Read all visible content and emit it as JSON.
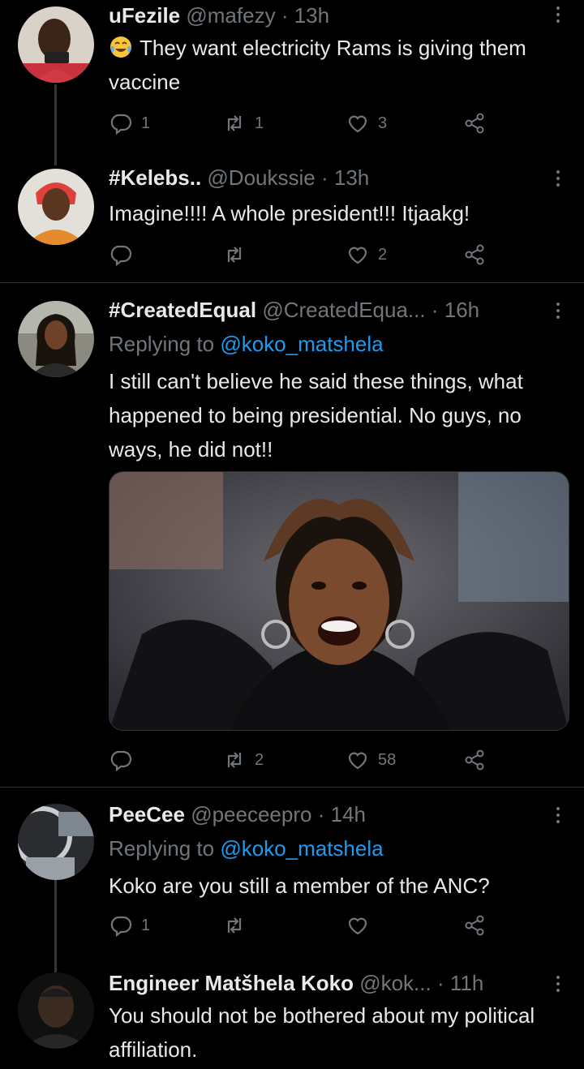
{
  "tweets": [
    {
      "name": "uFezile",
      "handle": "@mafezy",
      "sep": "·",
      "time": "13h",
      "text": "They want electricity Rams is giving them vaccine",
      "emoji": "face-with-tears-of-joy",
      "replies": "1",
      "retweets": "1",
      "likes": "3"
    },
    {
      "name": "#Kelebs..",
      "handle": "@Doukssie",
      "sep": "·",
      "time": "13h",
      "text": "Imagine!!!! A whole president!!! Itjaakg!",
      "replies": "",
      "retweets": "",
      "likes": "2"
    },
    {
      "name": "#CreatedEqual",
      "handle": "@CreatedEqua...",
      "sep": "·",
      "time": "16h",
      "replying_prefix": "Replying to",
      "replying_to": "@koko_matshela",
      "text": "I still can't believe he said these things, what happened to being presidential. No guys, no ways, he did not!!",
      "replies": "",
      "retweets": "2",
      "likes": "58"
    },
    {
      "name": "PeeCee",
      "handle": "@peeceepro",
      "sep": "·",
      "time": "14h",
      "replying_prefix": "Replying to",
      "replying_to": "@koko_matshela",
      "text": "Koko are you still a member of the ANC?",
      "replies": "1",
      "retweets": "",
      "likes": ""
    },
    {
      "name": "Engineer Matšhela Koko",
      "handle": "@kok...",
      "sep": "·",
      "time": "11h",
      "text": "You should not be bothered about my political affiliation."
    }
  ],
  "colors": {
    "background": "#000000",
    "text": "#e7e9ea",
    "muted": "#71767b",
    "link": "#1d9bf0",
    "divider": "#2f3336"
  }
}
